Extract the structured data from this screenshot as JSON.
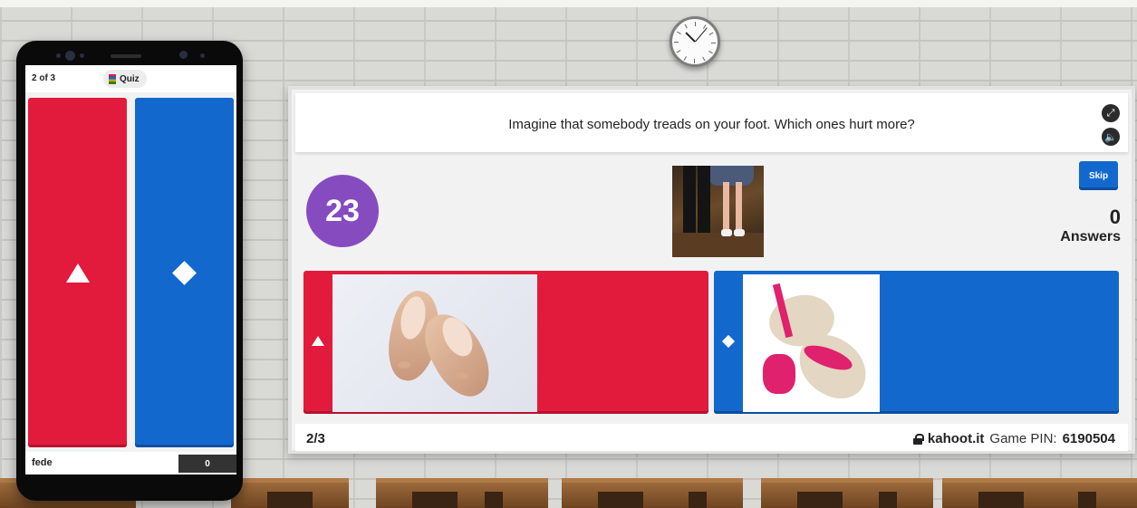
{
  "phone": {
    "question_counter": "2 of 3",
    "quiz_label": "Quiz",
    "nickname": "fede",
    "score": "0"
  },
  "question": {
    "text": "Imagine that somebody treads on your foot. Which ones hurt more?"
  },
  "timer": {
    "seconds": "23"
  },
  "skip": {
    "label": "Skip"
  },
  "answers_counter": {
    "count": "0",
    "label": "Answers"
  },
  "answers": [
    {
      "color": "#e21b3c",
      "shape": "triangle",
      "image": "flat-shoes"
    },
    {
      "color": "#1368ce",
      "shape": "diamond",
      "image": "high-heels"
    }
  ],
  "footer": {
    "progress": "2/3",
    "site": "kahoot.it",
    "pin_label": "Game PIN:",
    "pin": "6190504"
  },
  "colors": {
    "red": "#e21b3c",
    "blue": "#1368ce",
    "purple": "#864cbf"
  }
}
